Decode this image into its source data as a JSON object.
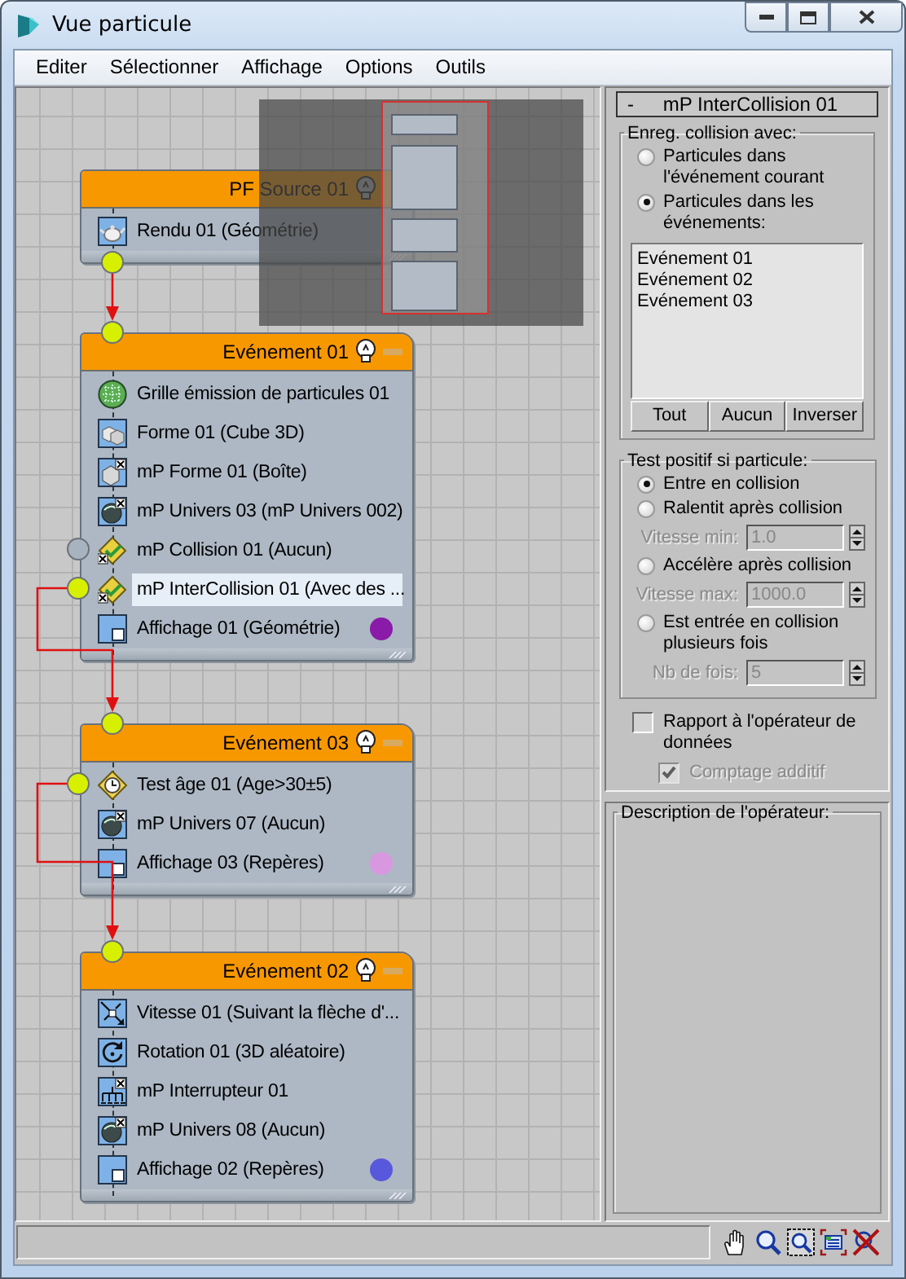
{
  "window": {
    "title": "Vue particule"
  },
  "menu": [
    "Editer",
    "Sélectionner",
    "Affichage",
    "Options",
    "Outils"
  ],
  "nodes": [
    {
      "title": "PF Source 01",
      "kind": "source",
      "rows": [
        {
          "label": "Rendu 01 (Géométrie)",
          "kind": "render",
          "selected": false
        }
      ]
    },
    {
      "title": "Evénement 01",
      "kind": "event",
      "rows": [
        {
          "label": "Grille émission de particules 01",
          "kind": "grid",
          "selected": false
        },
        {
          "label": "Forme 01 (Cube 3D)",
          "kind": "shape",
          "selected": false
        },
        {
          "label": "mP Forme 01 (Boîte)",
          "kind": "mp_shape",
          "selected": false
        },
        {
          "label": "mP Univers 03 (mP Univers 002)",
          "kind": "mp_world",
          "selected": false
        },
        {
          "label": "mP Collision 01 (Aucun)",
          "kind": "mp_collision",
          "selected": false,
          "port": {
            "connected": false
          }
        },
        {
          "label": "mP InterCollision 01 (Avec des ...",
          "kind": "mp_collision",
          "selected": true,
          "port": {
            "connected": true
          }
        },
        {
          "label": "Affichage 01 (Géométrie)",
          "kind": "display",
          "selected": false,
          "color": "#8a1aa8"
        }
      ]
    },
    {
      "title": "Evénement 03",
      "kind": "event",
      "rows": [
        {
          "label": "Test âge 01 (Age>30±5)",
          "kind": "age_test",
          "selected": false,
          "port": {
            "connected": true
          }
        },
        {
          "label": "mP Univers 07 (Aucun)",
          "kind": "mp_world",
          "selected": false
        },
        {
          "label": "Affichage 03 (Repères)",
          "kind": "display",
          "selected": false,
          "color": "#d898e0"
        }
      ]
    },
    {
      "title": "Evénement 02",
      "kind": "event",
      "rows": [
        {
          "label": "Vitesse 01 (Suivant la flèche d'...",
          "kind": "speed",
          "selected": false
        },
        {
          "label": "Rotation 01 (3D aléatoire)",
          "kind": "rotation",
          "selected": false
        },
        {
          "label": "mP Interrupteur  01",
          "kind": "mp_switch",
          "selected": false
        },
        {
          "label": "mP Univers 08 (Aucun)",
          "kind": "mp_world",
          "selected": false
        },
        {
          "label": "Affichage 02 (Repères)",
          "kind": "display",
          "selected": false,
          "color": "#5858dc"
        }
      ]
    }
  ],
  "panel": {
    "rollout": {
      "toggle": "-",
      "title": "mP InterCollision 01"
    },
    "record_group": {
      "title": "Enreg. collision avec:",
      "options": [
        {
          "label": "Particules dans l'événement courant",
          "selected": false
        },
        {
          "label": "Particules dans les événements:",
          "selected": true
        }
      ],
      "events": [
        "Evénement 01",
        "Evénement 02",
        "Evénement 03"
      ],
      "buttons": [
        "Tout",
        "Aucun",
        "Inverser"
      ]
    },
    "test_group": {
      "title": "Test positif si particule:",
      "items": [
        {
          "kind": "radio",
          "label": "Entre en collision",
          "selected": true
        },
        {
          "kind": "radio",
          "label": "Ralentit après collision",
          "selected": false
        },
        {
          "kind": "spinner",
          "label": "Vitesse min:",
          "value": "1.0",
          "disabled": true
        },
        {
          "kind": "radio",
          "label": "Accélère après collision",
          "selected": false
        },
        {
          "kind": "spinner",
          "label": "Vitesse max:",
          "value": "1000.0",
          "disabled": true
        },
        {
          "kind": "radio",
          "label": "Est entrée en collision plusieurs fois",
          "selected": false
        },
        {
          "kind": "spinner",
          "label": "Nb de fois:",
          "value": "5",
          "disabled": true
        }
      ]
    },
    "checkboxes": [
      {
        "label": "Rapport à l'opérateur de données",
        "checked": false,
        "disabled": false
      },
      {
        "label": "Comptage additif",
        "checked": true,
        "disabled": true
      }
    ],
    "description": {
      "title": "Description de l'opérateur:"
    }
  }
}
